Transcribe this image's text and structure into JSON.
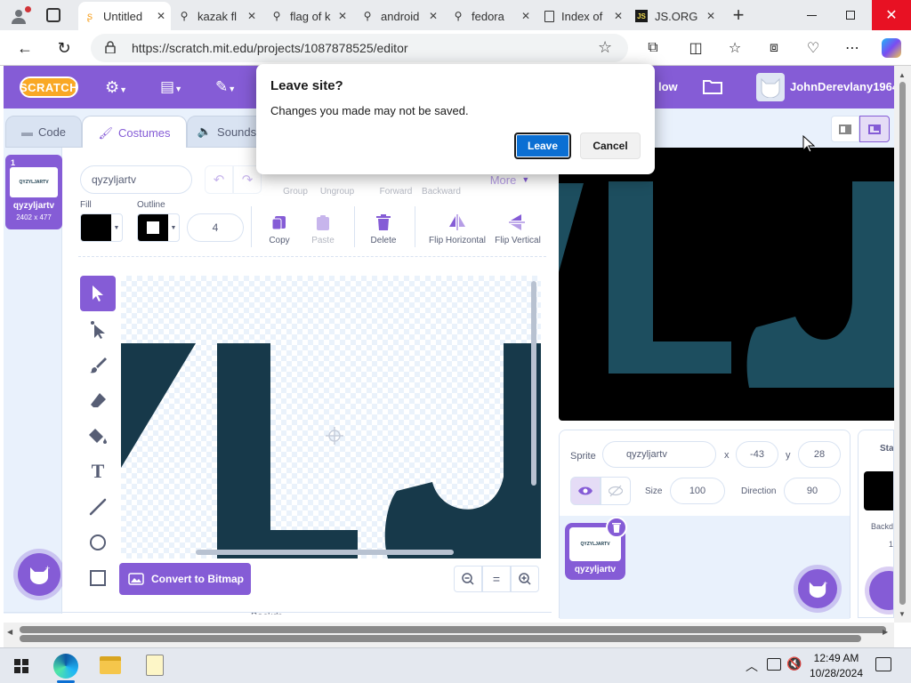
{
  "browser": {
    "tabs": [
      {
        "icon": "scratch-cat-icon",
        "label": "Untitled"
      },
      {
        "icon": "search-icon",
        "label": "kazak fl"
      },
      {
        "icon": "search-icon",
        "label": "flag of k"
      },
      {
        "icon": "search-icon",
        "label": "android"
      },
      {
        "icon": "search-icon",
        "label": "fedora"
      },
      {
        "icon": "document-icon",
        "label": "Index of"
      },
      {
        "icon": "js-icon",
        "label": "JS.ORG"
      }
    ],
    "url": "https://scratch.mit.edu/projects/1087878525/editor"
  },
  "scratch": {
    "logo": "SCRATCH",
    "menu_right_partial": "low",
    "username": "JohnDerevlany1964",
    "tabs": {
      "code": "Code",
      "costumes": "Costumes",
      "sounds": "Sounds"
    },
    "costume": {
      "number": "1",
      "name": "qyzyljartv",
      "size": "2402 x 477",
      "thumb_text": "QYZYLJARTV"
    },
    "paint": {
      "costume_name": "qyzyljartv",
      "group": "Group",
      "ungroup": "Ungroup",
      "forward": "Forward",
      "backward": "Backward",
      "more": "More",
      "fill": "Fill",
      "outline": "Outline",
      "outline_width": "4",
      "copy": "Copy",
      "paste": "Paste",
      "delete": "Delete",
      "flip_h": "Flip Horizontal",
      "flip_v": "Flip Vertical",
      "convert": "Convert to Bitmap",
      "zoom_reset": "=",
      "bottom_partial": "Backdr..."
    },
    "sprite": {
      "label": "Sprite",
      "name": "qyzyljartv",
      "x_label": "x",
      "x": "-43",
      "y_label": "y",
      "y": "28",
      "size_label": "Size",
      "size": "100",
      "direction_label": "Direction",
      "direction": "90",
      "thumb_name": "qyzyljartv",
      "thumb_text": "QYZYLJARTV"
    },
    "stage_panel": {
      "label": "Stag",
      "backdrops_label": "Backd",
      "backdrops_count": "1"
    }
  },
  "dialog": {
    "title": "Leave site?",
    "message": "Changes you made may not be saved.",
    "leave": "Leave",
    "cancel": "Cancel"
  },
  "taskbar": {
    "time": "12:49 AM",
    "date": "10/28/2024"
  },
  "colors": {
    "scratch_purple": "#855cd6",
    "art_teal": "#17394a",
    "stage_teal": "#1d4e5f",
    "leave_blue": "#0b6fd3"
  }
}
